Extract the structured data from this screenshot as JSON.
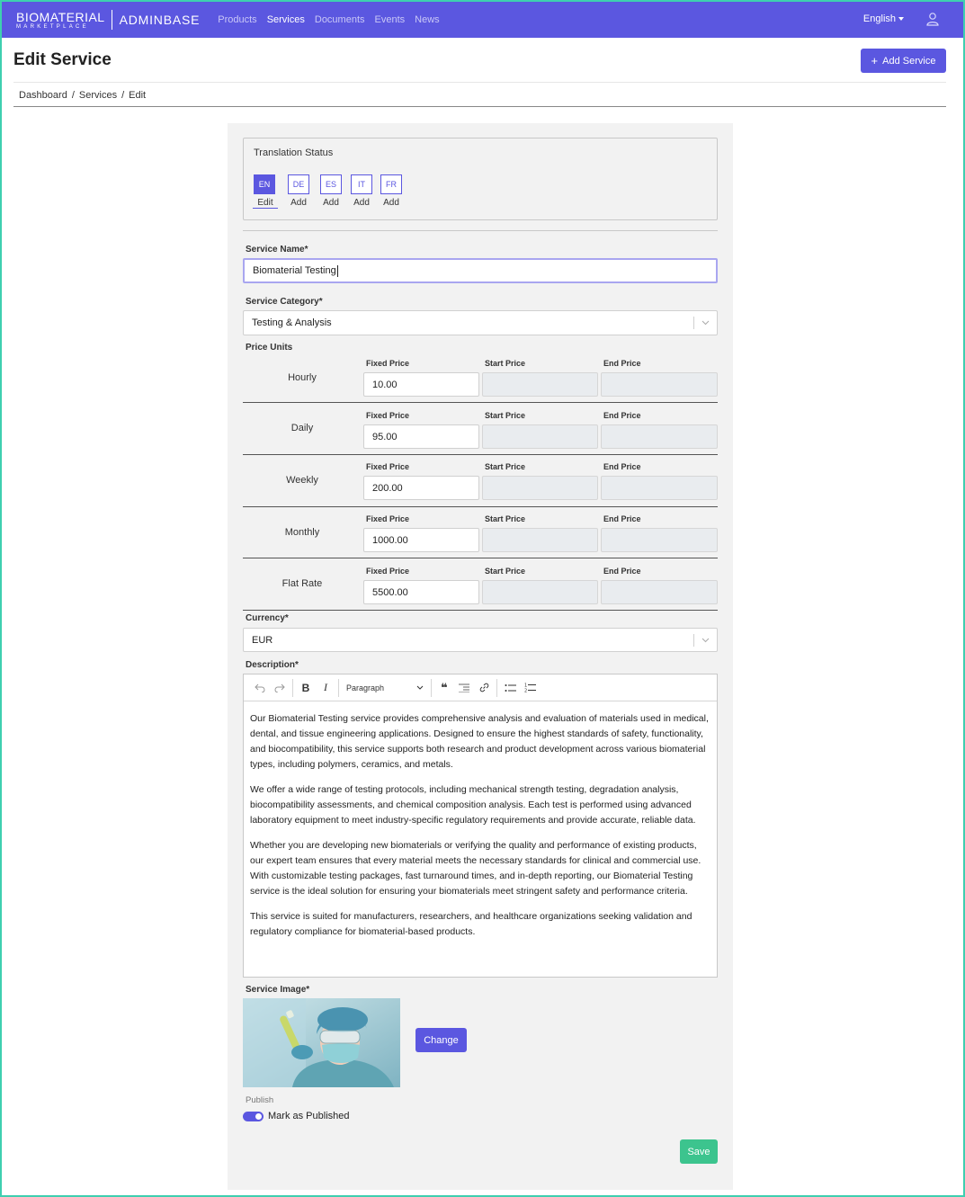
{
  "brand": {
    "name": "BIOMATERIAL",
    "sub": "MARKETPLACE",
    "app": "ADMINBASE"
  },
  "nav": {
    "items": [
      {
        "label": "Products"
      },
      {
        "label": "Services"
      },
      {
        "label": "Documents"
      },
      {
        "label": "Events"
      },
      {
        "label": "News"
      }
    ],
    "active": "Services",
    "language": "English"
  },
  "page": {
    "title": "Edit Service",
    "add_button": "Add Service",
    "breadcrumb": [
      "Dashboard",
      "Services",
      "Edit"
    ]
  },
  "translation": {
    "title": "Translation Status",
    "languages": [
      {
        "code": "EN",
        "action": "Edit"
      },
      {
        "code": "DE",
        "action": "Add"
      },
      {
        "code": "ES",
        "action": "Add"
      },
      {
        "code": "IT",
        "action": "Add"
      },
      {
        "code": "FR",
        "action": "Add"
      }
    ]
  },
  "form": {
    "service_name_label": "Service Name*",
    "service_name_value": "Biomaterial Testing",
    "category_label": "Service Category*",
    "category_value": "Testing & Analysis",
    "price_units_label": "Price Units",
    "price_columns": [
      "Fixed Price",
      "Start Price",
      "End Price"
    ],
    "price_rows": [
      {
        "unit": "Hourly",
        "fixed": "10.00"
      },
      {
        "unit": "Daily",
        "fixed": "95.00"
      },
      {
        "unit": "Weekly",
        "fixed": "200.00"
      },
      {
        "unit": "Monthly",
        "fixed": "1000.00"
      },
      {
        "unit": "Flat Rate",
        "fixed": "5500.00"
      }
    ],
    "currency_label": "Currency*",
    "currency_value": "EUR",
    "description_label": "Description*",
    "paragraph_style": "Paragraph",
    "description": [
      "Our Biomaterial Testing service provides comprehensive analysis and evaluation of materials used in medical, dental, and tissue engineering applications. Designed to ensure the highest standards of safety, functionality, and biocompatibility, this service supports both research and product development across various biomaterial types, including polymers, ceramics, and metals.",
      "We offer a wide range of testing protocols, including mechanical strength testing, degradation analysis, biocompatibility assessments, and chemical composition analysis. Each test is performed using advanced laboratory equipment to meet industry-specific regulatory requirements and provide accurate, reliable data.",
      "Whether you are developing new biomaterials or verifying the quality and performance of existing products, our expert team ensures that every material meets the necessary standards for clinical and commercial use. With customizable testing packages, fast turnaround times, and in-depth reporting, our Biomaterial Testing service is the ideal solution for ensuring your biomaterials meet stringent safety and performance criteria.",
      "This service is suited for manufacturers, researchers, and healthcare organizations seeking validation and regulatory compliance for biomaterial-based products."
    ],
    "image_label": "Service Image*",
    "change_button": "Change",
    "publish_label": "Publish",
    "publish_toggle_label": "Mark as Published",
    "published": true,
    "save_button": "Save"
  },
  "colors": {
    "primary": "#5b57e0",
    "success": "#3cc48e",
    "frame": "#3ecfb0"
  }
}
